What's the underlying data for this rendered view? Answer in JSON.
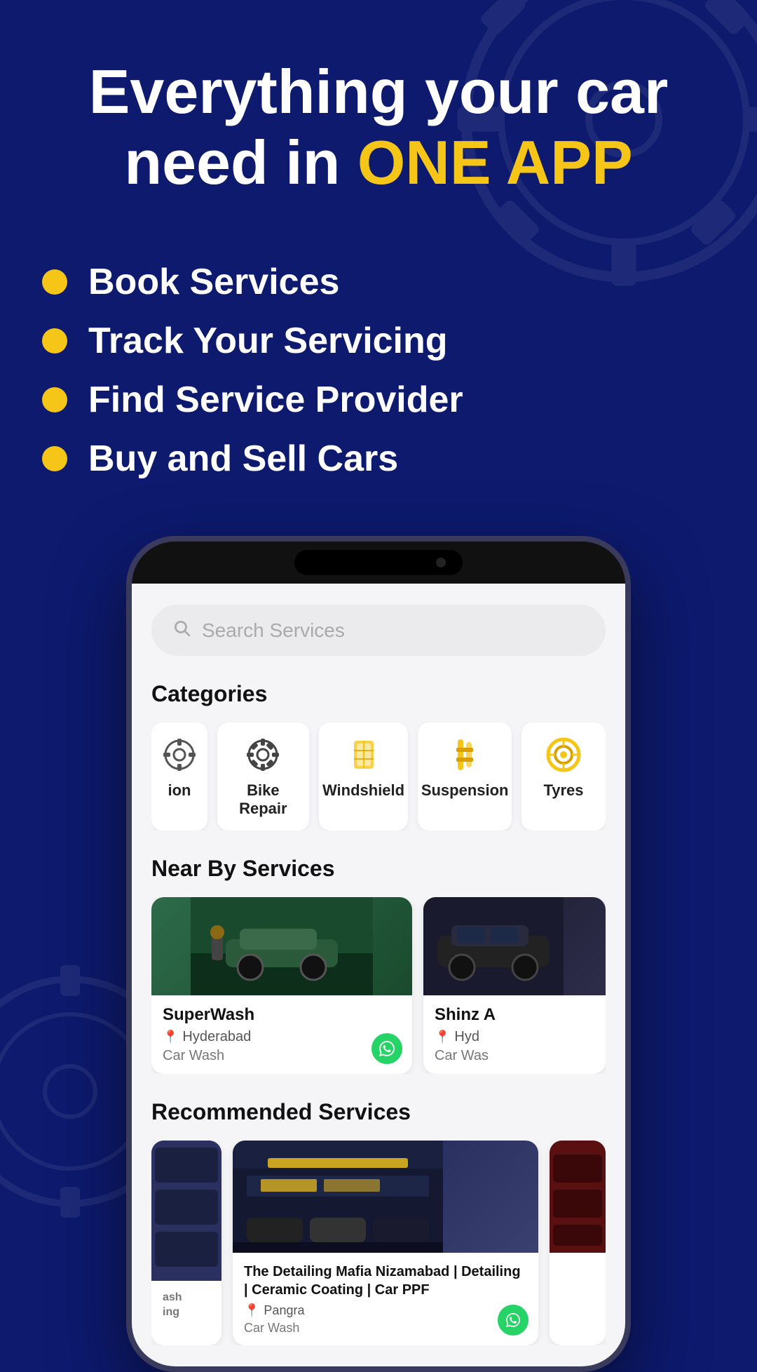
{
  "hero": {
    "title_line1": "Everything your car",
    "title_line2": "need in ",
    "title_highlight": "ONE APP"
  },
  "features": [
    {
      "label": "Book Services"
    },
    {
      "label": "Track Your Servicing"
    },
    {
      "label": "Find Service Provider"
    },
    {
      "label": "Buy and Sell Cars"
    }
  ],
  "phone": {
    "search": {
      "placeholder": "Search Services"
    },
    "categories": {
      "title": "Categories",
      "items": [
        {
          "label": "ion",
          "icon": "partial"
        },
        {
          "label": "Bike Repair",
          "icon": "gear"
        },
        {
          "label": "Windshield",
          "icon": "windshield"
        },
        {
          "label": "Suspension",
          "icon": "suspension"
        },
        {
          "label": "Tyres",
          "icon": "tyre"
        }
      ]
    },
    "nearby": {
      "title": "Near By Services",
      "items": [
        {
          "name": "SuperWash",
          "city": "Hyderabad",
          "type": "Car Wash",
          "img": "green"
        },
        {
          "name": "Shinz A",
          "city": "Hyd",
          "type": "Car Was",
          "img": "dark"
        }
      ]
    },
    "recommended": {
      "title": "Recommended Services",
      "items": [
        {
          "name": "ash\ning",
          "img": "dark",
          "partial": "left"
        },
        {
          "name": "The Detailing Mafia Nizamabad | Detailing | Ceramic Coating | Car PPF",
          "city": "Pangra",
          "type": "Car Wash",
          "img": "dark",
          "partial": false
        },
        {
          "name": "",
          "img": "red",
          "partial": "right"
        }
      ]
    }
  },
  "colors": {
    "background": "#0d1a6e",
    "highlight": "#f5c518",
    "white": "#ffffff",
    "whatsapp": "#25d366"
  }
}
